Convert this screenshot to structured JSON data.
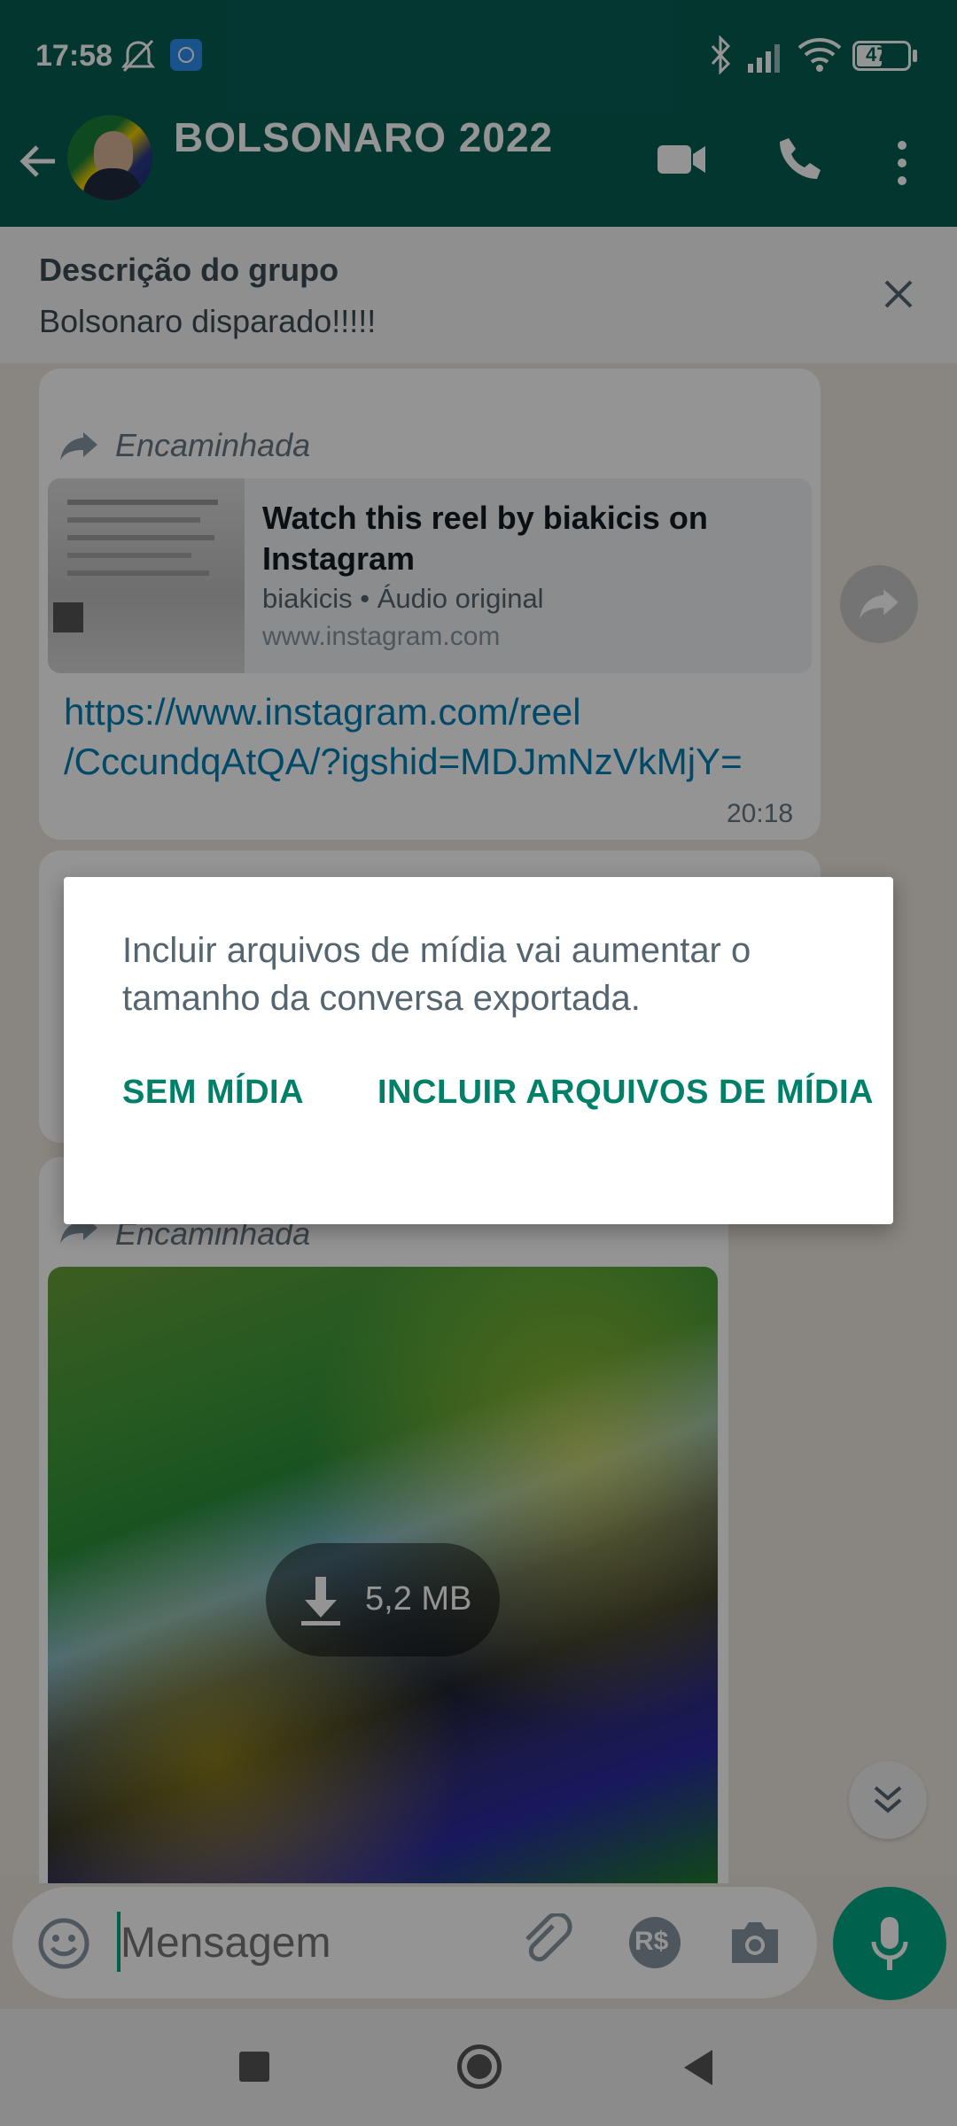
{
  "status_bar": {
    "time": "17:58",
    "battery": "47",
    "icons": [
      "alarm-off-icon",
      "app-notification-icon",
      "bluetooth-icon",
      "signal-icon",
      "wifi-icon",
      "battery-icon"
    ]
  },
  "header": {
    "title": "BOLSONARO 2022",
    "icons": [
      "back-arrow-icon",
      "group-avatar",
      "video-call-icon",
      "voice-call-icon",
      "more-vert-icon"
    ]
  },
  "group_description": {
    "heading": "Descrição do grupo",
    "text": "Bolsonaro disparado!!!!!"
  },
  "messages": [
    {
      "forwarded_label": "Encaminhada",
      "preview_title": "Watch this reel by biakicis on Instagram",
      "preview_subtitle": "biakicis • Áudio original",
      "preview_domain": "www.instagram.com",
      "link_line1": "https://www.instagram.com/reel",
      "link_line2": "/CccundqAtQA/?igshid=MDJmNzVkMjY=",
      "time": "20:18"
    },
    {
      "forwarded_label": "Encaminhada",
      "download_size": "5,2 MB"
    }
  ],
  "input": {
    "placeholder": "Mensagem"
  },
  "dialog": {
    "message": "Incluir arquivos de mídia vai aumentar o tamanho da conversa exportada.",
    "button_no_media": "SEM MÍDIA",
    "button_include_media": "INCLUIR ARQUIVOS DE MÍDIA"
  },
  "colors": {
    "header": "#075e54",
    "accent": "#008069",
    "mic": "#00a884",
    "link": "#027eb5"
  }
}
